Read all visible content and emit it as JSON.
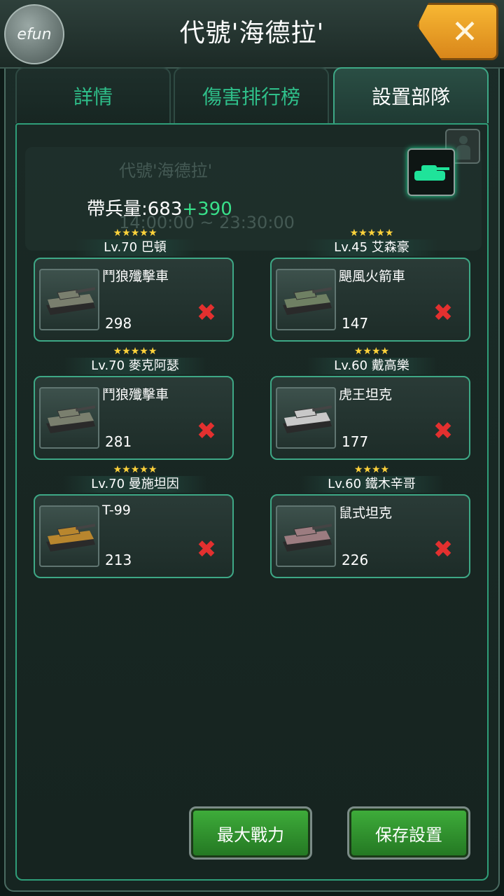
{
  "header": {
    "title": "代號'海德拉'",
    "logo_text": "efun",
    "close_label": "✕"
  },
  "tabs": [
    {
      "label": "詳情",
      "active": false
    },
    {
      "label": "傷害排行榜",
      "active": false
    },
    {
      "label": "設置部隊",
      "active": true
    }
  ],
  "background_card": {
    "title": "代號'海德拉'",
    "time": "14:00:00 ~ 23:30:00"
  },
  "troop": {
    "label": "帶兵量:683",
    "bonus": "+390"
  },
  "slots": [
    {
      "stars": "★★★★★",
      "general": "Lv.70 巴頓",
      "unit": "鬥狼殲擊車",
      "count": "298",
      "tank_color": "#7a7f6e"
    },
    {
      "stars": "★★★★★",
      "general": "Lv.45 艾森豪",
      "unit": "颶風火箭車",
      "count": "147",
      "tank_color": "#6f8063"
    },
    {
      "stars": "★★★★★",
      "general": "Lv.70 麥克阿瑟",
      "unit": "鬥狼殲擊車",
      "count": "281",
      "tank_color": "#7a7f6e"
    },
    {
      "stars": "★★★★",
      "general": "Lv.60 戴高樂",
      "unit": "虎王坦克",
      "count": "177",
      "tank_color": "#c8c8c8"
    },
    {
      "stars": "★★★★★",
      "general": "Lv.70 曼施坦因",
      "unit": "T-99",
      "count": "213",
      "tank_color": "#b8862e"
    },
    {
      "stars": "★★★★",
      "general": "Lv.60 鐵木辛哥",
      "unit": "鼠式坦克",
      "count": "226",
      "tank_color": "#9c7c80"
    }
  ],
  "remove_icon": "✖",
  "buttons": {
    "max_power": "最大戰力",
    "save": "保存設置"
  },
  "colors": {
    "accent": "#3ea886",
    "remove": "#e3302f",
    "bonus": "#39e08a",
    "stars": "#ffd23b"
  }
}
